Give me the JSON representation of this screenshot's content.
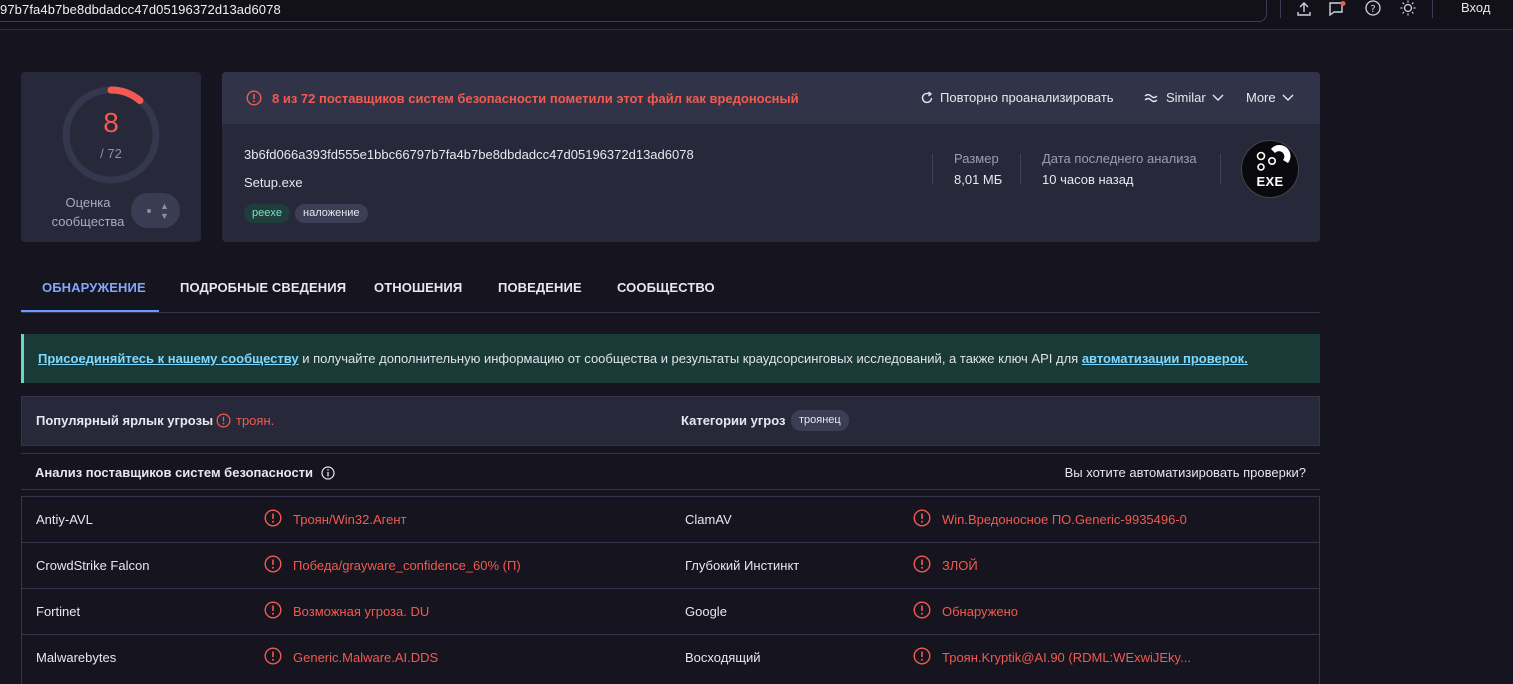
{
  "topbar": {
    "search_value": "97b7fa4b7be8dbdadcc47d05196372d13ad6078",
    "icons": [
      "upload-icon",
      "chat-icon",
      "help-icon",
      "theme-icon"
    ],
    "login_label": "Вход"
  },
  "score": {
    "detections": "8",
    "total": "/ 72",
    "fraction": 0.111,
    "community_label": "Оценка сообщества"
  },
  "file": {
    "alert": "8 из 72 поставщиков систем безопасности пометили этот файл как вредоносный",
    "reanalyze_label": "Повторно проанализировать",
    "similar_label": "Similar",
    "more_label": "More",
    "hash": "3b6fd066a393fd555e1bbc66797b7fa4b7be8dbdadcc47d05196372d13ad6078",
    "name": "Setup.exe",
    "tags": [
      "peexe",
      "наложение"
    ],
    "size_label": "Размер",
    "size_value": "8,01 МБ",
    "date_label": "Дата последнего анализа",
    "date_value": "10 часов назад",
    "type_badge": "EXE"
  },
  "tabs": [
    "ОБНАРУЖЕНИЕ",
    "ПОДРОБНЫЕ СВЕДЕНИЯ",
    "ОТНОШЕНИЯ",
    "ПОВЕДЕНИЕ",
    "СООБЩЕСТВО"
  ],
  "banner": {
    "link1": "Присоединяйтесь к нашему сообществу",
    "text": " и получайте дополнительную информацию от сообщества и результаты краудсорсинговых исследований, а также ключ API для ",
    "link2": "автоматизации проверок."
  },
  "threat": {
    "popular_label": "Популярный ярлык угрозы",
    "popular_value": "троян.",
    "categories_label": "Категории угроз",
    "category": "троянец"
  },
  "vendors": {
    "title": "Анализ поставщиков систем безопасности",
    "automate": "Вы хотите автоматизировать проверки?",
    "rows": [
      {
        "name1": "Antiy-AVL",
        "res1": "Троян/Win32.Агент",
        "name2": "ClamAV",
        "res2": "Win.Вредоносное ПО.Generic-9935496-0"
      },
      {
        "name1": "CrowdStrike Falcon",
        "res1": "Победа/grayware_confidence_60% (П)",
        "name2": "Глубокий Инстинкт",
        "res2": "ЗЛОЙ"
      },
      {
        "name1": "Fortinet",
        "res1": "Возможная угроза. DU",
        "name2": "Google",
        "res2": "Обнаружено"
      },
      {
        "name1": "Malwarebytes",
        "res1": "Generic.Malware.AI.DDS",
        "name2": "Восходящий",
        "res2": "Троян.Kryptik@AI.90 (RDML:WExwiJEky..."
      }
    ]
  },
  "colors": {
    "background": "#16141f",
    "card": "#27293b",
    "danger": "#f25a4f",
    "accent": "#7fa8ff",
    "banner": "#1a3a37"
  }
}
